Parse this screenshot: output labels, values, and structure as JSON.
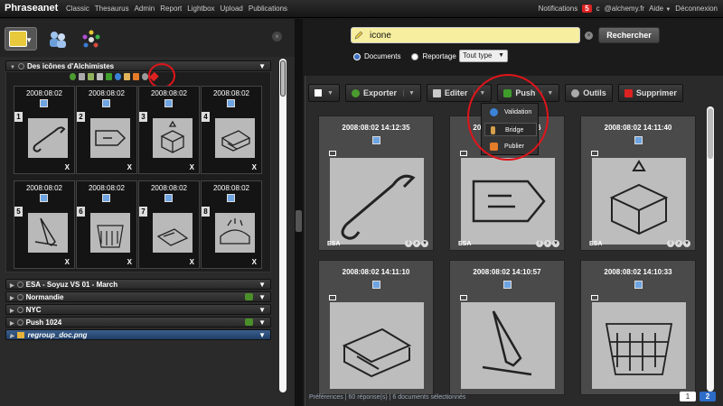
{
  "app": {
    "brand": "Phraseanet"
  },
  "nav": [
    "Classic",
    "Thesaurus",
    "Admin",
    "Report",
    "Lightbox",
    "Upload",
    "Publications"
  ],
  "user_nav": {
    "notifications": "Notifications",
    "notif_count": "5",
    "c": "c",
    "account": "@alchemy.fr",
    "help": "Aide",
    "help_caret": "▼",
    "logout": "Déconnexion"
  },
  "basket": {
    "title": "Des icônes d'Alchimistes",
    "items": [
      {
        "date": "2008:08:02",
        "num": "1",
        "remove": "X"
      },
      {
        "date": "2008:08:02",
        "num": "2",
        "remove": "X"
      },
      {
        "date": "2008:08:02",
        "num": "3",
        "remove": "X"
      },
      {
        "date": "2008:08:02",
        "num": "4",
        "remove": "X"
      },
      {
        "date": "2008:08:02",
        "num": "5",
        "remove": "X"
      },
      {
        "date": "2008:08:02",
        "num": "6",
        "remove": "X"
      },
      {
        "date": "2008:08:02",
        "num": "7",
        "remove": "X"
      },
      {
        "date": "2008:08:02",
        "num": "8",
        "remove": "X"
      }
    ]
  },
  "baskets": [
    {
      "title": "ESA - Soyuz VS 01 - March"
    },
    {
      "title": "Normandie"
    },
    {
      "title": "NYC"
    },
    {
      "title": "Push 1024"
    },
    {
      "title": "regroup_doc.png"
    }
  ],
  "search": {
    "value": "icone",
    "button": "Rechercher",
    "clear": "×"
  },
  "filters": {
    "documents": "Documents",
    "reportage": "Reportage",
    "sort": "Tout type"
  },
  "toolbar": {
    "export": "Exporter",
    "edit": "Editer",
    "push": "Push",
    "tools": "Outils",
    "delete": "Supprimer",
    "caret": "▼"
  },
  "push_menu": {
    "validation": "Validation",
    "bridge": "Bridge",
    "publish": "Publier"
  },
  "results": [
    {
      "date": "2008:08:02 14:12:35",
      "collection": "ESA",
      "icon": "wrench-icon"
    },
    {
      "date": "2008:08:02 14:12:16",
      "collection": "ESA",
      "icon": "tag-icon"
    },
    {
      "date": "2008:08:02 14:11:40",
      "collection": "ESA",
      "icon": "box-icon"
    },
    {
      "date": "2008:08:02 14:11:10",
      "collection": "",
      "icon": "printer-icon"
    },
    {
      "date": "2008:08:02 14:10:57",
      "collection": "",
      "icon": "pencil-icon"
    },
    {
      "date": "2008:08:02 14:10:33",
      "collection": "",
      "icon": "basket-icon"
    }
  ],
  "status": {
    "prefs": "Préférences",
    "sep": "|",
    "answers": "60 réponse(s)",
    "selected": "6 documents sélectionnés"
  },
  "pager": {
    "p1": "1",
    "p2": "2"
  },
  "colors": {
    "accent": "#2d6cc9",
    "highlight": "#e0141a",
    "search_bg": "#f7ef9f"
  }
}
